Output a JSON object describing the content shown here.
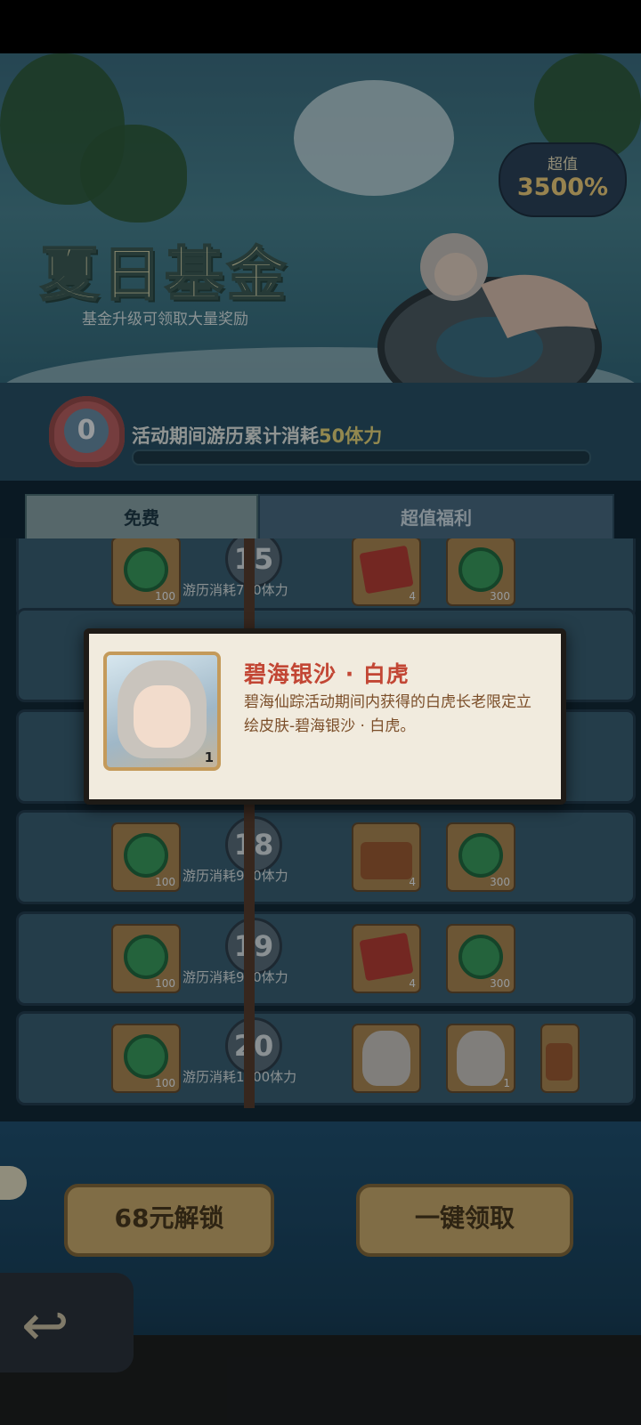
{
  "banner": {
    "title": "夏日基金",
    "subtitle": "基金升级可领取大量奖励",
    "badge_small": "超值",
    "badge_big": "3500%"
  },
  "progress": {
    "level": "0",
    "text_prefix": "活动期间游历累计消耗",
    "text_highlight": "50体力",
    "fill_fraction": 0
  },
  "tabs": {
    "free": "免费",
    "premium": "超值福利"
  },
  "rows": [
    {
      "level": "15",
      "cost": "游历消耗750体力",
      "free_qty": "100",
      "prem1_qty": "4",
      "prem2_qty": "300"
    },
    {
      "level": "18",
      "cost": "游历消耗900体力",
      "free_qty": "100",
      "prem1_qty": "4",
      "prem2_qty": "300"
    },
    {
      "level": "19",
      "cost": "游历消耗950体力",
      "free_qty": "100",
      "prem1_qty": "4",
      "prem2_qty": "300"
    },
    {
      "level": "20",
      "cost": "游历消耗1000体力",
      "free_qty": "100",
      "prem1_qty": "",
      "prem2_qty": "1"
    }
  ],
  "tooltip": {
    "title": "碧海银沙 · 白虎",
    "description": "碧海仙踪活动期间内获得的白虎长老限定立绘皮肤-碧海银沙 · 白虎。",
    "qty": "1"
  },
  "buttons": {
    "unlock": "68元解锁",
    "claim": "一键领取",
    "back": "↩"
  }
}
